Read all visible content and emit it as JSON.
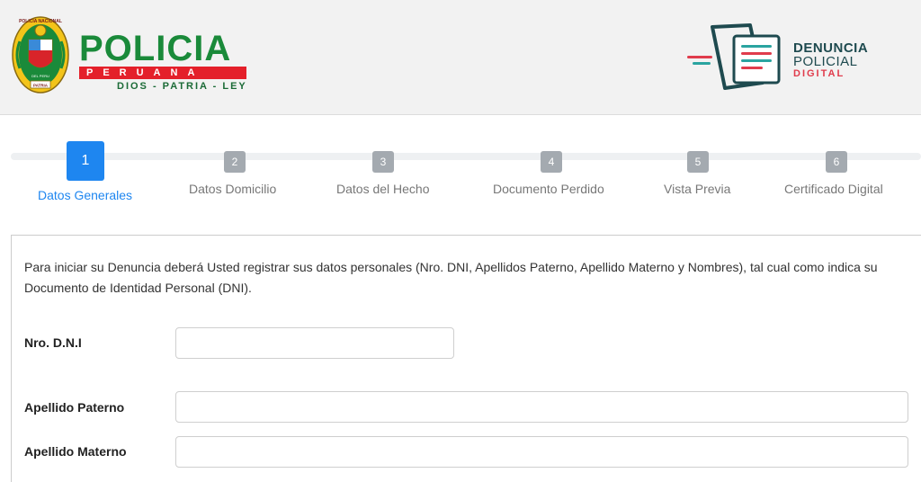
{
  "header": {
    "logo_word": "POLICIA",
    "logo_band": "PERUANA",
    "logo_motto": "DIOS - PATRIA - LEY",
    "crest_top_text": "POLICIA NACIONAL",
    "crest_mid_text": "DEL PERU",
    "crest_bottom_text": "PATRIA",
    "app_logo": {
      "line1": "DENUNCIA",
      "line2": "POLICIAL",
      "line3": "DIGITAL"
    },
    "colors": {
      "police_green": "#1a8a3a",
      "police_red": "#e4202a",
      "app_teal": "#1e4a4f",
      "app_red": "#e03c4c"
    }
  },
  "steps": [
    {
      "number": "1",
      "label": "Datos Generales",
      "active": true
    },
    {
      "number": "2",
      "label": "Datos Domicilio",
      "active": false
    },
    {
      "number": "3",
      "label": "Datos del Hecho",
      "active": false
    },
    {
      "number": "4",
      "label": "Documento Perdido",
      "active": false
    },
    {
      "number": "5",
      "label": "Vista Previa",
      "active": false
    },
    {
      "number": "6",
      "label": "Certificado Digital",
      "active": false
    }
  ],
  "form": {
    "intro": "Para iniciar su Denuncia deberá Usted registrar sus datos personales (Nro. DNI, Apellidos Paterno, Apellido Materno y Nombres), tal cual como indica su Documento de Identidad Personal (DNI).",
    "fields": {
      "dni": {
        "label": "Nro. D.N.I",
        "value": ""
      },
      "apellido_paterno": {
        "label": "Apellido Paterno",
        "value": ""
      },
      "apellido_materno": {
        "label": "Apellido Materno",
        "value": ""
      }
    }
  },
  "accent_color": "#1e86f0"
}
